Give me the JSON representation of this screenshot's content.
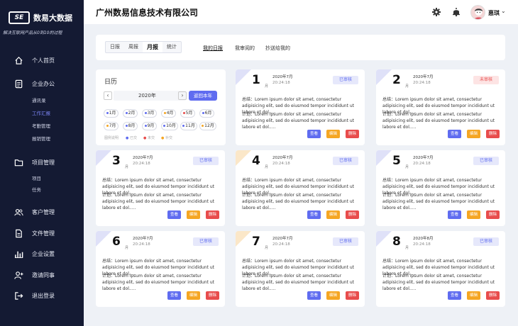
{
  "sidebar": {
    "logo_mark": "SE",
    "logo_text": "数易大数据",
    "slogan": "解决互联网产品从0到10的过程",
    "items": [
      {
        "label": "个人首页",
        "icon": "home-icon"
      },
      {
        "label": "企业办公",
        "icon": "document-icon"
      },
      {
        "label": "项目管理",
        "icon": "folder-icon"
      },
      {
        "label": "客户管理",
        "icon": "users-icon"
      },
      {
        "label": "文件管理",
        "icon": "file-icon"
      },
      {
        "label": "企业设置",
        "icon": "settings-icon"
      },
      {
        "label": "邀请同事",
        "icon": "add-user-icon"
      },
      {
        "label": "退出登录",
        "icon": "logout-icon"
      }
    ],
    "office_sub": [
      "通讯录",
      "工作汇报",
      "考勤管理",
      "报销管理"
    ],
    "project_sub": [
      "项目",
      "任务"
    ]
  },
  "topbar": {
    "company": "广州数易信息技术有限公司",
    "username": "惠琪"
  },
  "tabs": {
    "periods": [
      "日报",
      "周报",
      "月报",
      "统计"
    ],
    "views": [
      "我的日报",
      "我审阅的",
      "抄送给我的"
    ]
  },
  "calendar": {
    "title": "日历",
    "year": "2020年",
    "btn": "返回本年",
    "months": [
      "1月",
      "2月",
      "3月",
      "4月",
      "5月",
      "6月",
      "7月",
      "8月",
      "9月",
      "10月",
      "11月",
      "12月"
    ],
    "legend": [
      "图例说明",
      "已交",
      "未交",
      "补交"
    ],
    "colors": {
      "submitted": "#5f6cf0",
      "missing": "#e84c4c",
      "late": "#f5a623"
    }
  },
  "card_labels": {
    "yue": "月",
    "summary_prefix": "总结：",
    "plan_prefix": "计划：",
    "view": "查看",
    "edit": "编辑",
    "delete": "删除"
  },
  "cards": [
    {
      "num": "1",
      "date": "2020年7月",
      "time": "20:24:18",
      "status": "已审核",
      "summary": "Lorem ipsum dolor sit amet, consectetur adipisicing elit, sed do eiusmod tempor incididunt ut labore et dol.....",
      "plan": "Lorem ipsum dolor sit amet, consectetur adipisicing elit, sed do eiusmod tempor incididunt ut labore et dol....."
    },
    {
      "num": "2",
      "date": "2020年7月",
      "time": "20:24:18",
      "status": "未审核",
      "summary": "Lorem ipsum dolor sit amet, consectetur adipisicing elit, sed do eiusmod tempor incididunt ut labore et dol.....",
      "plan": "Lorem ipsum dolor sit amet, consectetur adipisicing elit, sed do eiusmod tempor incididunt ut labore et dol....."
    },
    {
      "num": "3",
      "date": "2020年7月",
      "time": "20:24:18",
      "status": "已审核",
      "summary": "Lorem ipsum dolor sit amet, consectetur adipisicing elit, sed do eiusmod tempor incididunt ut labore et dol.....",
      "plan": "Lorem ipsum dolor sit amet, consectetur adipisicing elit, sed do eiusmod tempor incididunt ut labore et dol....."
    },
    {
      "num": "4",
      "date": "2020年7月",
      "time": "20:24:18",
      "status": "已审核",
      "summary": "Lorem ipsum dolor sit amet, consectetur adipisicing elit, sed do eiusmod tempor incididunt ut labore et dol.....",
      "plan": "Lorem ipsum dolor sit amet, consectetur adipisicing elit, sed do eiusmod tempor incididunt ut labore et dol....."
    },
    {
      "num": "5",
      "date": "2020年7月",
      "time": "20:24:18",
      "status": "已审核",
      "summary": "Lorem ipsum dolor sit amet, consectetur adipisicing elit, sed do eiusmod tempor incididunt ut labore et dol.....",
      "plan": "Lorem ipsum dolor sit amet, consectetur adipisicing elit, sed do eiusmod tempor incididunt ut labore et dol....."
    },
    {
      "num": "6",
      "date": "2020年7月",
      "time": "20:24:18",
      "status": "已审核",
      "summary": "Lorem ipsum dolor sit amet, consectetur adipisicing elit, sed do eiusmod tempor incididunt ut labore et dol.....",
      "plan": "Lorem ipsum dolor sit amet, consectetur adipisicing elit, sed do eiusmod tempor incididunt ut labore et dol....."
    },
    {
      "num": "7",
      "date": "2020年7月",
      "time": "20:24:18",
      "status": "已审核",
      "summary": "Lorem ipsum dolor sit amet, consectetur adipisicing elit, sed do eiusmod tempor incididunt ut labore et dol.....",
      "plan": "Lorem ipsum dolor sit amet, consectetur adipisicing elit, sed do eiusmod tempor incididunt ut labore et dol....."
    },
    {
      "num": "8",
      "date": "2020年8月",
      "time": "20:24:18",
      "status": "已审核",
      "summary": "Lorem ipsum dolor sit amet, consectetur adipisicing elit, sed do eiusmod tempor incididunt ut labore et dol.....",
      "plan": "Lorem ipsum dolor sit amet, consectetur adipisicing elit, sed do eiusmod tempor incididunt ut labore et dol....."
    }
  ]
}
